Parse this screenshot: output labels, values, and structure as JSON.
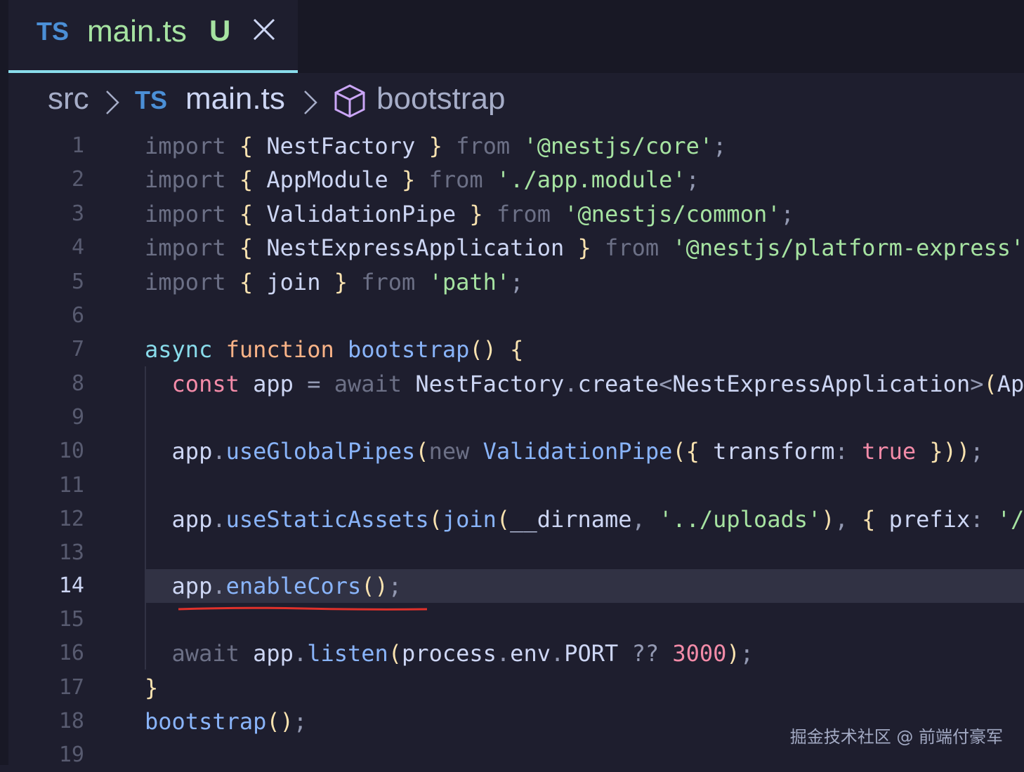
{
  "tab": {
    "icon": "TS",
    "label": "main.ts",
    "badge": "U",
    "close_icon": "close-icon"
  },
  "breadcrumb": {
    "folder": "src",
    "file_icon": "TS",
    "file": "main.ts",
    "symbol_icon": "cube-icon",
    "symbol": "bootstrap"
  },
  "editor": {
    "active_line": 14,
    "line_numbers": [
      "1",
      "2",
      "3",
      "4",
      "5",
      "6",
      "7",
      "8",
      "9",
      "10",
      "11",
      "12",
      "13",
      "14",
      "15",
      "16",
      "17",
      "18",
      "19"
    ],
    "lines": [
      "import { NestFactory } from '@nestjs/core';",
      "import { AppModule } from './app.module';",
      "import { ValidationPipe } from '@nestjs/common';",
      "import { NestExpressApplication } from '@nestjs/platform-express';",
      "import { join } from 'path';",
      "",
      "async function bootstrap() {",
      "  const app = await NestFactory.create<NestExpressApplication>(AppM",
      "",
      "  app.useGlobalPipes(new ValidationPipe({ transform: true }));",
      "",
      "  app.useStaticAssets(join(__dirname, '../uploads'), { prefix: '/up",
      "",
      "  app.enableCors();",
      "",
      "  await app.listen(process.env.PORT ?? 3000);",
      "}",
      "bootstrap();",
      ""
    ]
  },
  "colors": {
    "background": "#1e1e2e",
    "tab_accent": "#89dceb",
    "squiggle": "#e0312b"
  },
  "watermark": "掘金技术社区 @ 前端付豪军"
}
